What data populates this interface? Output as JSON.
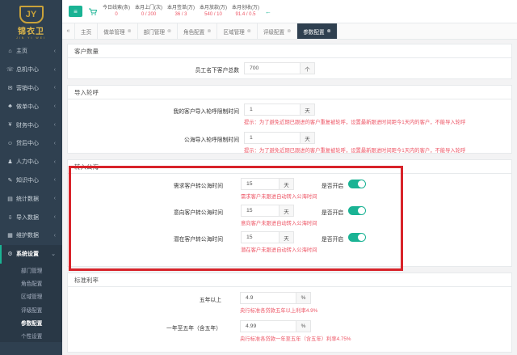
{
  "brand": {
    "name": "锦衣卫",
    "sub": "JIN YI WEI",
    "badge": "JY"
  },
  "sidebar": {
    "items": [
      {
        "icon": "⌂",
        "label": "主页",
        "chevron": "‹"
      },
      {
        "icon": "☏",
        "label": "总机中心",
        "chevron": "‹"
      },
      {
        "icon": "✉",
        "label": "营销中心",
        "chevron": "‹"
      },
      {
        "icon": "♣",
        "label": "做单中心",
        "chevron": "‹"
      },
      {
        "icon": "¥",
        "label": "财务中心",
        "chevron": "‹"
      },
      {
        "icon": "☺",
        "label": "贷后中心",
        "chevron": "‹"
      },
      {
        "icon": "♟",
        "label": "人力中心",
        "chevron": "‹"
      },
      {
        "icon": "✎",
        "label": "知识中心",
        "chevron": "‹"
      },
      {
        "icon": "▤",
        "label": "统计数据",
        "chevron": "‹"
      },
      {
        "icon": "⇩",
        "label": "导入数据",
        "chevron": "‹"
      },
      {
        "icon": "▦",
        "label": "维护数据",
        "chevron": "‹"
      },
      {
        "icon": "⚙",
        "label": "系统设置",
        "chevron": "⌄"
      }
    ],
    "sub_items": [
      "部门管理",
      "角色配置",
      "区域管理",
      "评级配置",
      "参数配置",
      "个性设置"
    ]
  },
  "topbar": {
    "menu_icon": "≡",
    "stats": [
      {
        "label": "今日线索(条)",
        "value": "0"
      },
      {
        "label": "本月上门(次)",
        "value": "0 / 200"
      },
      {
        "label": "本月签单(万)",
        "value": "36 / 3"
      },
      {
        "label": "本月放款(万)",
        "value": "540 / 10"
      },
      {
        "label": "本月创收(万)",
        "value": "91.4 / 0.5"
      }
    ],
    "arrow": "←"
  },
  "tabs": {
    "prev": "«",
    "items": [
      {
        "label": "主页",
        "closable": false
      },
      {
        "label": "做单管理",
        "closable": true
      },
      {
        "label": "部门管理",
        "closable": true
      },
      {
        "label": "角色配置",
        "closable": true
      },
      {
        "label": "区域管理",
        "closable": true
      },
      {
        "label": "评级配置",
        "closable": true
      },
      {
        "label": "参数配置",
        "closable": true,
        "active": true
      }
    ],
    "close_glyph": "⊗"
  },
  "sections": {
    "customers": {
      "title": "客户数量",
      "field_label": "员工名下客户总数",
      "value": "700",
      "unit": "个"
    },
    "import": {
      "title": "导入轮呼",
      "rows": [
        {
          "label": "我的客户导入轮呼限制时间",
          "value": "1",
          "unit": "天",
          "hint": "提示：为了避免近期已跟进的客户重复被轮呼，设置最新跟进时间距今1天内的客户，不能导入轮呼"
        },
        {
          "label": "公海导入轮呼限制时间",
          "value": "1",
          "unit": "天",
          "hint": "提示：为了避免近期已跟进的客户重复被轮呼，设置最新跟进时间距今1天内的客户，不能导入轮呼"
        }
      ]
    },
    "public_sea": {
      "title": "转入公海",
      "toggle_label": "是否开启",
      "rows": [
        {
          "label": "需求客户转公海时间",
          "value": "15",
          "unit": "天",
          "hint": "需求客户未跟进自动转入公海时间",
          "enabled": true
        },
        {
          "label": "意向客户转公海时间",
          "value": "15",
          "unit": "天",
          "hint": "意向客户未跟进自动转入公海时间",
          "enabled": true
        },
        {
          "label": "潜在客户转公海时间",
          "value": "15",
          "unit": "天",
          "hint": "潜在客户未跟进自动转入公海时间",
          "enabled": true
        }
      ]
    },
    "rates": {
      "title": "标准利率",
      "rows": [
        {
          "label": "五年以上",
          "value": "4.9",
          "unit": "%",
          "hint": "央行标准各贷款五年以上利率4.9%"
        },
        {
          "label": "一年至五年（含五年）",
          "value": "4.99",
          "unit": "%",
          "hint": "央行标准各贷款一年至五年（含五年）利率4.75%"
        }
      ]
    }
  },
  "colors": {
    "accent": "#1ab394",
    "sidebar": "#2f4050",
    "hint": "#ed5565",
    "highlight": "#d8232a"
  }
}
